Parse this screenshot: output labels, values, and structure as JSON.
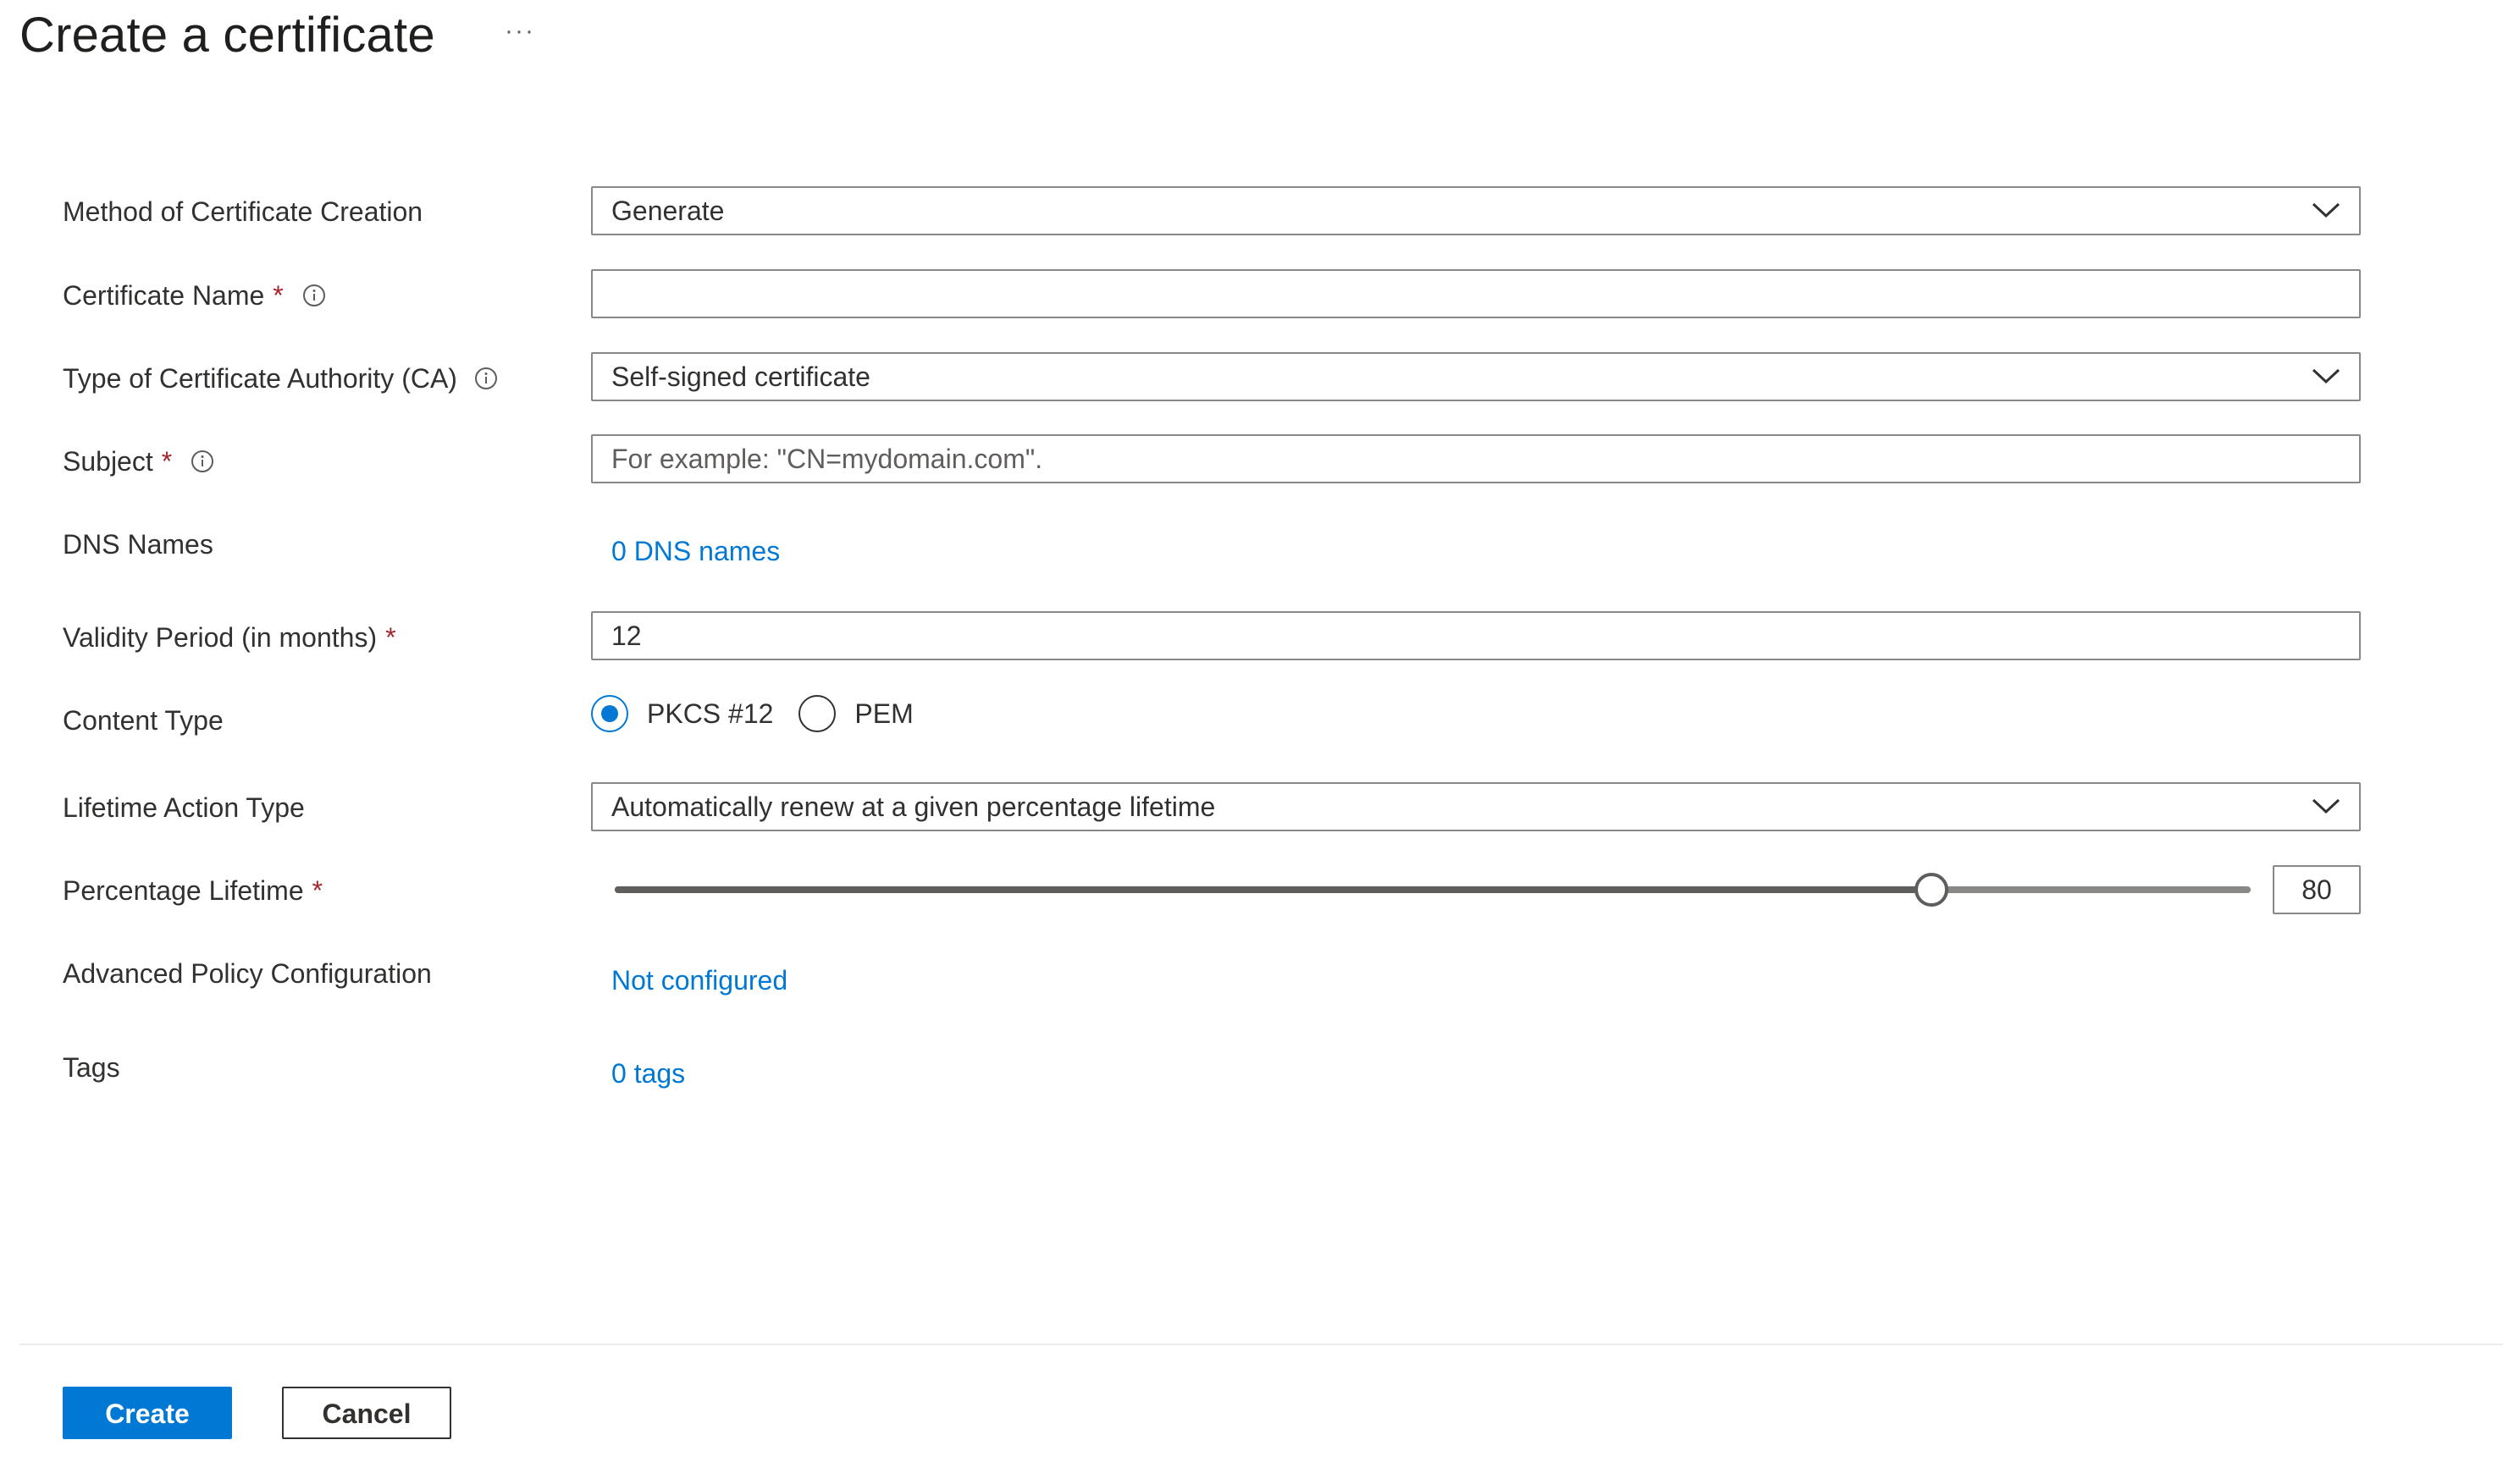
{
  "page": {
    "title": "Create a certificate",
    "more_glyph": "···"
  },
  "form": {
    "method": {
      "label": "Method of Certificate Creation",
      "value": "Generate"
    },
    "certificate_name": {
      "label": "Certificate Name",
      "required_mark": "*",
      "value": ""
    },
    "ca_type": {
      "label": "Type of Certificate Authority (CA)",
      "value": "Self-signed certificate"
    },
    "subject": {
      "label": "Subject",
      "required_mark": "*",
      "placeholder": "For example: \"CN=mydomain.com\"."
    },
    "dns_names": {
      "label": "DNS Names",
      "link": "0 DNS names"
    },
    "validity": {
      "label": "Validity Period (in months)",
      "required_mark": "*",
      "value": "12"
    },
    "content_type": {
      "label": "Content Type",
      "options": [
        {
          "label": "PKCS #12",
          "checked": true
        },
        {
          "label": "PEM",
          "checked": false
        }
      ]
    },
    "lifetime_action": {
      "label": "Lifetime Action Type",
      "value": "Automatically renew at a given percentage lifetime"
    },
    "percentage_lifetime": {
      "label": "Percentage Lifetime",
      "required_mark": "*",
      "value": "80",
      "fraction": 0.805
    },
    "advanced_policy": {
      "label": "Advanced Policy Configuration",
      "link": "Not configured"
    },
    "tags": {
      "label": "Tags",
      "link": "0 tags"
    }
  },
  "footer": {
    "create_label": "Create",
    "cancel_label": "Cancel"
  },
  "colors": {
    "accent": "#0078d4",
    "required": "#a4262c",
    "border": "#8a8886"
  },
  "icons": {
    "info": "info-icon",
    "dropdown": "chevron-down-icon",
    "more": "more-icon"
  }
}
